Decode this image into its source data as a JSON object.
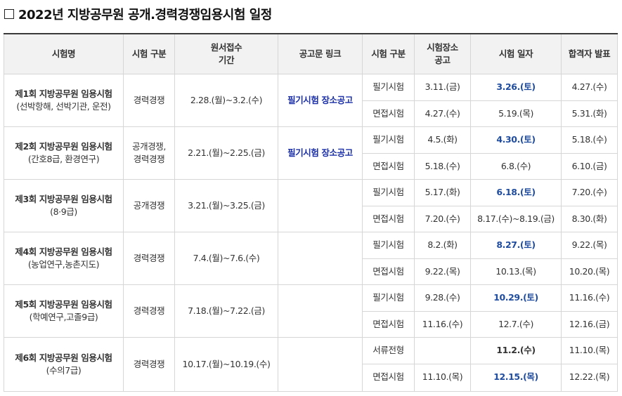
{
  "title": "2022년 지방공무원 공개.경력경쟁임용시험 일정",
  "headers": [
    "시험명",
    "시험 구분",
    "원서접수\n기간",
    "공고문 링크",
    "시험 구분",
    "시험장소\n공고",
    "시험 일자",
    "합격자 발표"
  ],
  "exams": [
    {
      "name": "제1회 지방공무원 임용시험",
      "sub": "(선박항해, 선박기관, 운전)",
      "type": "경력경쟁",
      "period": "2.28.(월)~3.2.(수)",
      "link": "필기시험 장소공고",
      "rows": [
        {
          "stage": "필기시험",
          "venue": "3.11.(금)",
          "date": "3.26.(토)",
          "result": "4.27.(수)"
        },
        {
          "stage": "면접시험",
          "venue": "4.27.(수)",
          "date": "5.19.(목)",
          "result": "5.31.(화)"
        }
      ]
    },
    {
      "name": "제2회 지방공무원 임용시험",
      "sub": "(간호8급, 환경연구)",
      "type": "공개경쟁,\n경력경쟁",
      "period": "2.21.(월)~2.25.(금)",
      "link": "필기시험 장소공고",
      "rows": [
        {
          "stage": "필기시험",
          "venue": "4.5.(화)",
          "date": "4.30.(토)",
          "result": "5.18.(수)"
        },
        {
          "stage": "면접시험",
          "venue": "5.18.(수)",
          "date": "6.8.(수)",
          "result": "6.10.(금)"
        }
      ]
    },
    {
      "name": "제3회 지방공무원 임용시험",
      "sub": "(8·9급)",
      "type": "공개경쟁",
      "period": "3.21.(월)~3.25.(금)",
      "link": "",
      "rows": [
        {
          "stage": "필기시험",
          "venue": "5.17.(화)",
          "date": "6.18.(토)",
          "result": "7.20.(수)"
        },
        {
          "stage": "면접시험",
          "venue": "7.20.(수)",
          "date": "8.17.(수)~8.19.(금)",
          "result": "8.30.(화)"
        }
      ]
    },
    {
      "name": "제4회 지방공무원 임용시험",
      "sub": "(농업연구,농촌지도)",
      "type": "경력경쟁",
      "period": "7.4.(월)~7.6.(수)",
      "link": "",
      "rows": [
        {
          "stage": "필기시험",
          "venue": "8.2.(화)",
          "date": "8.27.(토)",
          "result": "9.22.(목)"
        },
        {
          "stage": "면접시험",
          "venue": "9.22.(목)",
          "date": "10.13.(목)",
          "result": "10.20.(목)"
        }
      ]
    },
    {
      "name": "제5회 지방공무원 임용시험",
      "sub": "(학예연구,고졸9급)",
      "type": "경력경쟁",
      "period": "7.18.(월)~7.22.(금)",
      "link": "",
      "rows": [
        {
          "stage": "필기시험",
          "venue": "9.28.(수)",
          "date": "10.29.(토)",
          "result": "11.16.(수)"
        },
        {
          "stage": "면접시험",
          "venue": "11.16.(수)",
          "date": "12.7.(수)",
          "result": "12.16.(금)"
        }
      ]
    },
    {
      "name": "제6회 지방공무원 임용시험",
      "sub": "(수의7급)",
      "type": "경력경쟁",
      "period": "10.17.(월)~10.19.(수)",
      "link": "",
      "rows": [
        {
          "stage": "서류전형",
          "venue": "",
          "date": "11.2.(수)",
          "result": "11.10.(목)"
        },
        {
          "stage": "면접시험",
          "venue": "11.10.(목)",
          "date": "12.15.(목)",
          "result": "12.22.(목)"
        }
      ]
    }
  ],
  "colors": {
    "link": "#1a2fa8",
    "exam_date": "#1f4c9e",
    "header_bg": "#f2f2f2"
  }
}
